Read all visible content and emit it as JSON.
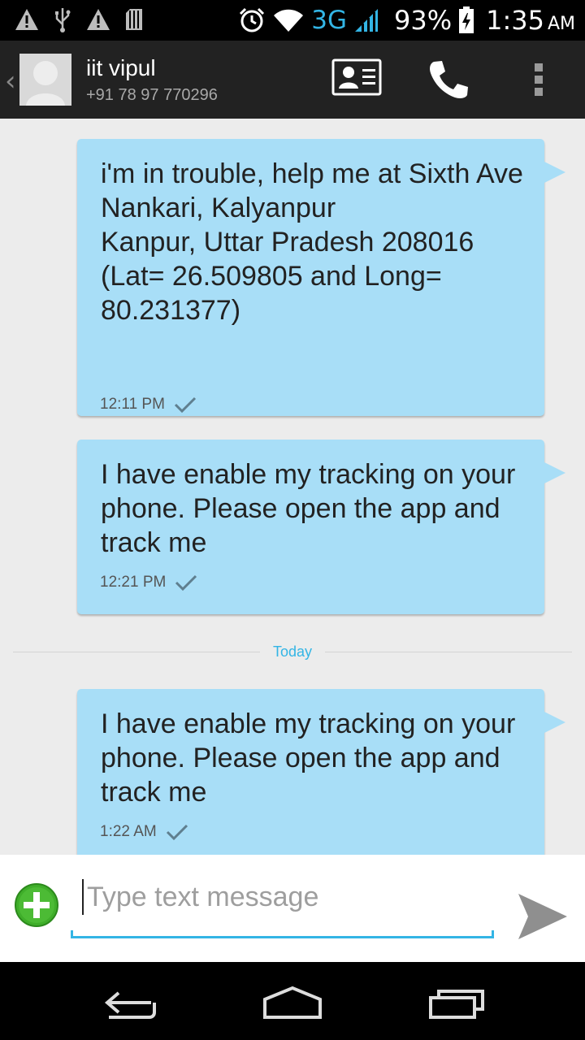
{
  "status_bar": {
    "network_type": "3G",
    "battery": "93%",
    "time": "1:35",
    "ampm": "AM",
    "icons": [
      "warning-icon",
      "usb-icon",
      "warning-icon",
      "sd-card-icon",
      "alarm-icon",
      "wifi-icon",
      "signal-icon",
      "battery-charging-icon"
    ]
  },
  "header": {
    "contact_name": "iit vipul",
    "contact_number": "+91 78 97 770296",
    "icons": [
      "back-chevron-icon",
      "avatar-icon",
      "contact-card-icon",
      "phone-icon",
      "overflow-menu-icon"
    ]
  },
  "messages": [
    {
      "text": "i'm in trouble, help me at Sixth Ave\nNankari, Kalyanpur\nKanpur, Uttar Pradesh 208016\n(Lat= 26.509805 and Long= 80.231377)",
      "time": "12:11 PM",
      "status_icon": "sent-check-icon"
    },
    {
      "text": "I have enable my tracking on your phone. Please open the app and track me",
      "time": "12:21 PM",
      "status_icon": "sent-check-icon"
    },
    {
      "text": "I have enable my tracking on your phone. Please open the app and track me",
      "time": "1:22 AM",
      "status_icon": "sent-check-icon"
    }
  ],
  "date_divider": "Today",
  "compose": {
    "placeholder": "Type text message",
    "value": "",
    "icons": [
      "add-attachment-icon",
      "send-icon"
    ]
  },
  "nav": {
    "icons": [
      "back-icon",
      "home-icon",
      "recents-icon"
    ]
  },
  "colors": {
    "accent": "#33b5e5",
    "bubble": "#a8def7",
    "attach_green": "#3fae2a"
  }
}
